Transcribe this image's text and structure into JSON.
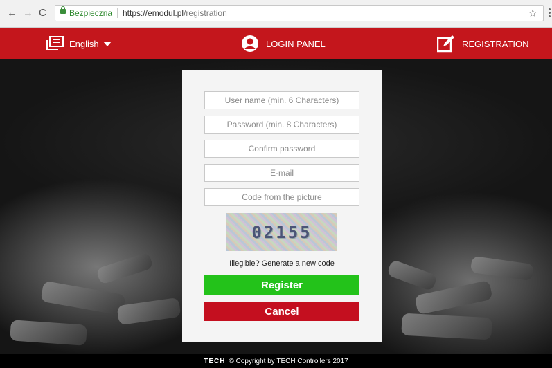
{
  "browser": {
    "secure_label": "Bezpieczna",
    "url_host": "https://emodul.pl",
    "url_path": "/registration",
    "back_icon": "←",
    "forward_icon": "→",
    "reload_icon": "C",
    "bookmark_icon": "☆"
  },
  "header": {
    "language": "English",
    "login": "LOGIN PANEL",
    "registration": "REGISTRATION",
    "accent_color": "#c4161c"
  },
  "form": {
    "username_placeholder": "User name (min. 6 Characters)",
    "password_placeholder": "Password (min. 8 Characters)",
    "confirm_placeholder": "Confirm password",
    "email_placeholder": "E-mail",
    "code_placeholder": "Code from the picture",
    "captcha_text": "02155",
    "new_code_link": "Illegible? Generate a new code",
    "register_label": "Register",
    "cancel_label": "Cancel",
    "register_color": "#23c21a",
    "cancel_color": "#c40f1f"
  },
  "footer": {
    "brand": "TECH",
    "copyright": "© Copyright by TECH Controllers 2017"
  }
}
